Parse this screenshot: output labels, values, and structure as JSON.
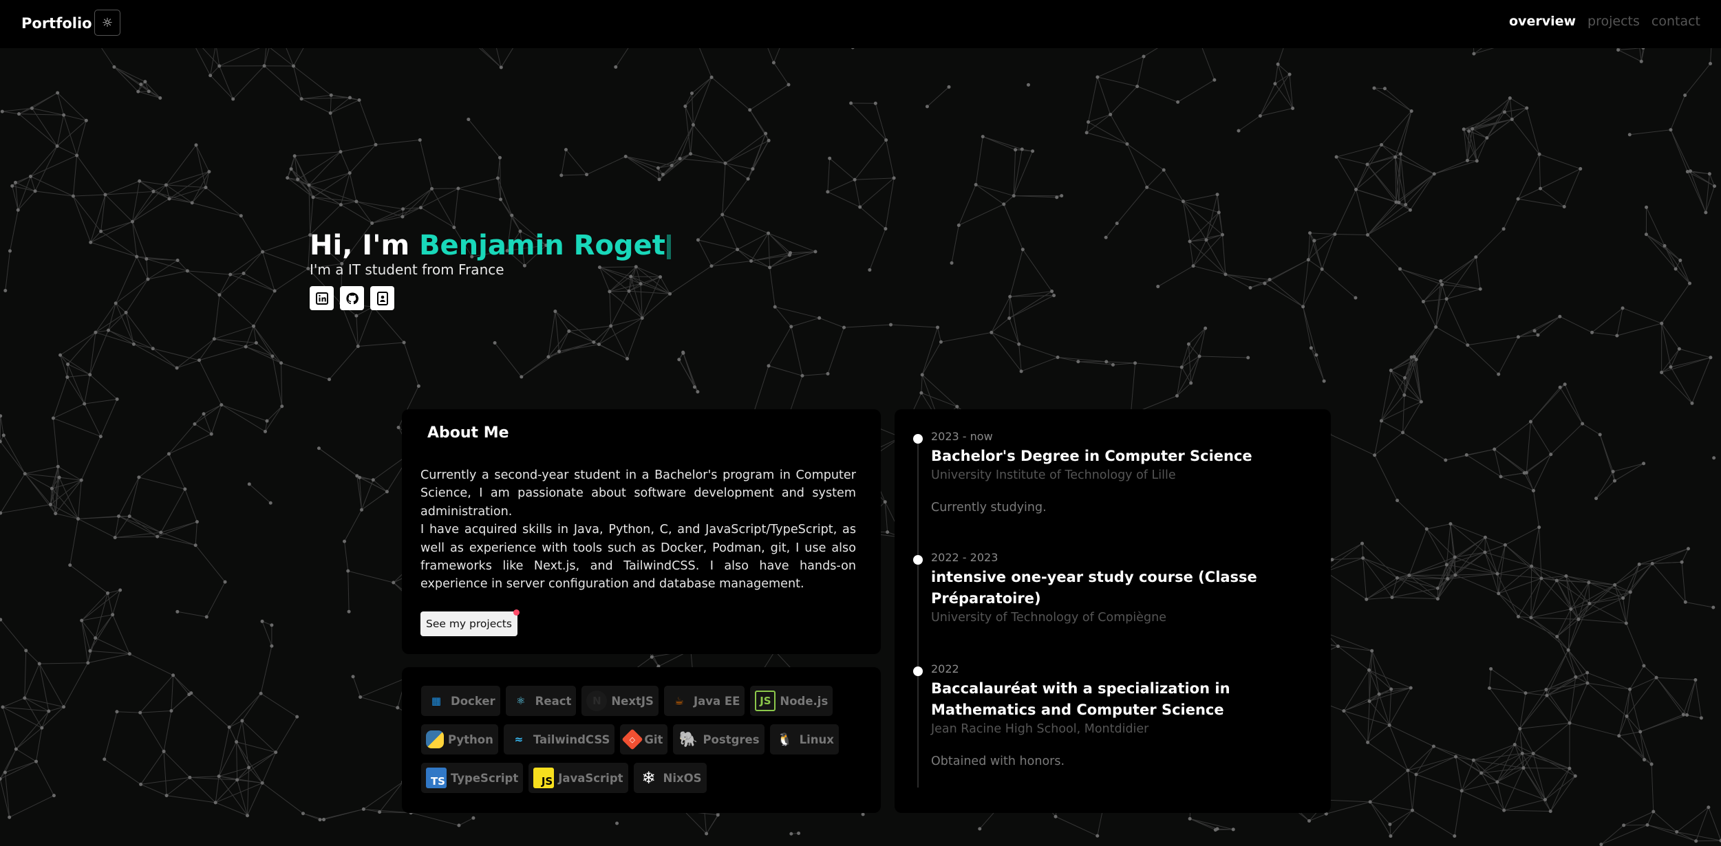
{
  "nav": {
    "brand": "Portfolio",
    "theme_icon": "sun-icon",
    "links": [
      "overview",
      "projects",
      "contact"
    ],
    "active": "overview"
  },
  "hero": {
    "greeting": "Hi, I'm",
    "name": "Benjamin Roget",
    "subtitle": "I'm a IT student from France",
    "socials": [
      "linkedin-icon",
      "github-icon",
      "contact-card-icon"
    ]
  },
  "about": {
    "title": "About Me",
    "paragraphs": [
      "Currently a second-year student in a Bachelor's program in Computer Science, I am passionate about software development and system administration.",
      "I have acquired skills in Java, Python, C, and JavaScript/TypeScript, as well as experience with tools such as Docker, Podman, git, I use also frameworks like Next.js, and TailwindCSS. I also have hands-on experience in server configuration and database management."
    ],
    "button_label": "See my projects"
  },
  "skills": [
    [
      {
        "label": "Docker",
        "icon": "docker-icon"
      },
      {
        "label": "React",
        "icon": "react-icon"
      },
      {
        "label": "NextJS",
        "icon": "nextjs-icon"
      },
      {
        "label": "Java EE",
        "icon": "java-icon"
      },
      {
        "label": "Node.js",
        "icon": "nodejs-icon"
      }
    ],
    [
      {
        "label": "Python",
        "icon": "python-icon"
      },
      {
        "label": "TailwindCSS",
        "icon": "tailwind-icon"
      },
      {
        "label": "Git",
        "icon": "git-icon"
      },
      {
        "label": "Postgres",
        "icon": "postgres-icon"
      },
      {
        "label": "Linux",
        "icon": "linux-icon"
      }
    ],
    [
      {
        "label": "TypeScript",
        "icon": "typescript-icon"
      },
      {
        "label": "JavaScript",
        "icon": "javascript-icon"
      },
      {
        "label": "NixOS",
        "icon": "nixos-icon"
      }
    ]
  ],
  "timeline": [
    {
      "date": "2023 - now",
      "title": "Bachelor's Degree in Computer Science",
      "school": "University Institute of Technology of Lille",
      "description": "Currently studying."
    },
    {
      "date": "2022 - 2023",
      "title": "intensive one-year study course (Classe Préparatoire)",
      "school": "University of Technology of Compiègne",
      "description": ""
    },
    {
      "date": "2022",
      "title": "Baccalauréat with a specialization in Mathematics and Computer Science",
      "school": "Jean Racine High School, Montdidier",
      "description": "Obtained with honors."
    }
  ],
  "colors": {
    "accent": "#19d8ba",
    "background": "#0b0c0b",
    "card": "#000000"
  }
}
